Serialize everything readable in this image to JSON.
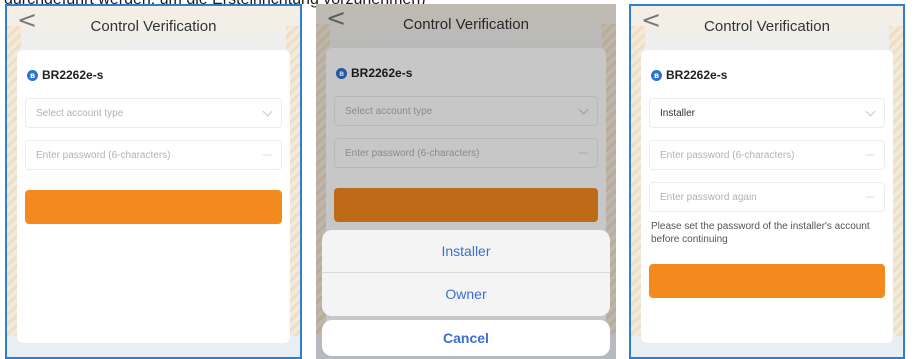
{
  "caption": "durchgeführt werden, um die Ersteinrichtung vorzunehmen)",
  "screens": [
    {
      "title": "Control Verification",
      "device_name": "BR2262e-s",
      "account_type_placeholder": "Select account type",
      "password_placeholder": "Enter password (6-characters)"
    },
    {
      "title": "Control Verification",
      "device_name": "BR2262e-s",
      "account_type_placeholder": "Select account type",
      "password_placeholder": "Enter password (6-characters)",
      "action_sheet": {
        "options": [
          "Installer",
          "Owner"
        ],
        "cancel_label": "Cancel"
      }
    },
    {
      "title": "Control Verification",
      "device_name": "BR2262e-s",
      "account_type_value": "Installer",
      "password_placeholder": "Enter password (6-characters)",
      "password_again_placeholder": "Enter password again",
      "hint": "Please set the password of the installer's account before continuing"
    }
  ],
  "icons": {
    "back": "chevron-left",
    "device": "bluetooth",
    "dropdown": "chevron-down",
    "password_visibility": "eye-closed"
  },
  "colors": {
    "accent": "#f28a1e",
    "frame": "#2d7fd1",
    "sheet_text": "#3a6fcf"
  }
}
